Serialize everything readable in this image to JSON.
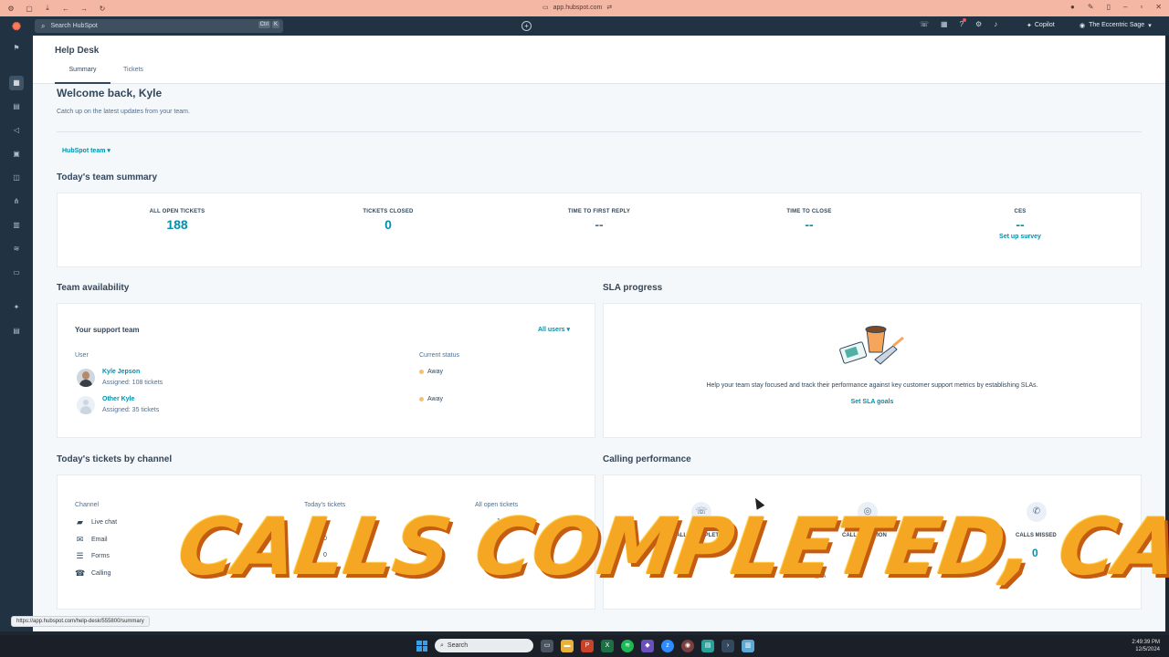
{
  "browser": {
    "url": "app.hubspot.com"
  },
  "topnav": {
    "search_placeholder": "Search HubSpot",
    "shortcut_keys": [
      "Ctrl",
      "K"
    ],
    "copilot_label": "Copilot",
    "account_name": "The Eccentric Sage",
    "icons": [
      "phone-icon",
      "marketplace-icon",
      "help-icon",
      "settings-icon",
      "notifications-icon"
    ]
  },
  "sidebar": {
    "icons": [
      "bookmark-icon",
      "workspaces-icon",
      "contacts-icon",
      "marketing-icon",
      "content-icon",
      "commerce-icon",
      "automation-icon",
      "reporting-icon",
      "data-icon",
      "library-icon",
      "breeze-icon",
      "more-icon"
    ]
  },
  "page": {
    "title": "Help Desk",
    "tabs": [
      "Summary",
      "Tickets"
    ],
    "active_tab": "Summary",
    "welcome": "Welcome back, Kyle",
    "welcome_sub": "Catch up on the latest updates from your team.",
    "team_filter": "HubSpot team ▾"
  },
  "summary": {
    "title": "Today's team summary",
    "metrics": [
      {
        "label": "ALL OPEN TICKETS",
        "value": "188"
      },
      {
        "label": "TICKETS CLOSED",
        "value": "0"
      },
      {
        "label": "TIME TO FIRST REPLY",
        "value": "--"
      },
      {
        "label": "TIME TO CLOSE",
        "value": "--"
      },
      {
        "label": "CES",
        "value": "--",
        "link": "Set up survey"
      }
    ]
  },
  "availability": {
    "section_title": "Team availability",
    "card_title": "Your support team",
    "filter": "All users ▾",
    "col_user": "User",
    "col_status": "Current status",
    "users": [
      {
        "name": "Kyle Jepson",
        "assigned": "Assigned: 108 tickets",
        "status": "Away"
      },
      {
        "name": "Other Kyle",
        "assigned": "Assigned: 35 tickets",
        "status": "Away"
      }
    ]
  },
  "sla": {
    "section_title": "SLA progress",
    "text": "Help your team stay focused and track their performance against key customer support metrics by establishing SLAs.",
    "link": "Set SLA goals"
  },
  "channels": {
    "section_title": "Today's tickets by channel",
    "col_channel": "Channel",
    "col_today": "Today's tickets",
    "col_open": "All open tickets",
    "rows": [
      {
        "name": "Live chat",
        "icon": "chat-icon",
        "today": "",
        "open": "1"
      },
      {
        "name": "Email",
        "icon": "email-icon",
        "today": "0",
        "open": "0"
      },
      {
        "name": "Forms",
        "icon": "forms-icon",
        "today": "0",
        "open": ""
      },
      {
        "name": "Calling",
        "icon": "phone-icon",
        "today": "",
        "open": ""
      }
    ]
  },
  "calling": {
    "section_title": "Calling performance",
    "metrics": [
      {
        "label": "CALLS COMPLETED",
        "value": "0"
      },
      {
        "label": "CALL DURATION",
        "value": "-"
      },
      {
        "label": "CALLS MISSED",
        "value": "0"
      }
    ],
    "note": "@ A"
  },
  "caption": "CALLS COMPLETED, CALL",
  "status_bar_url": "https://app.hubspot.com/help-desk/555800/summary",
  "taskbar": {
    "search": "Search",
    "time": "2:49:39 PM",
    "date": "12/5/2024"
  }
}
